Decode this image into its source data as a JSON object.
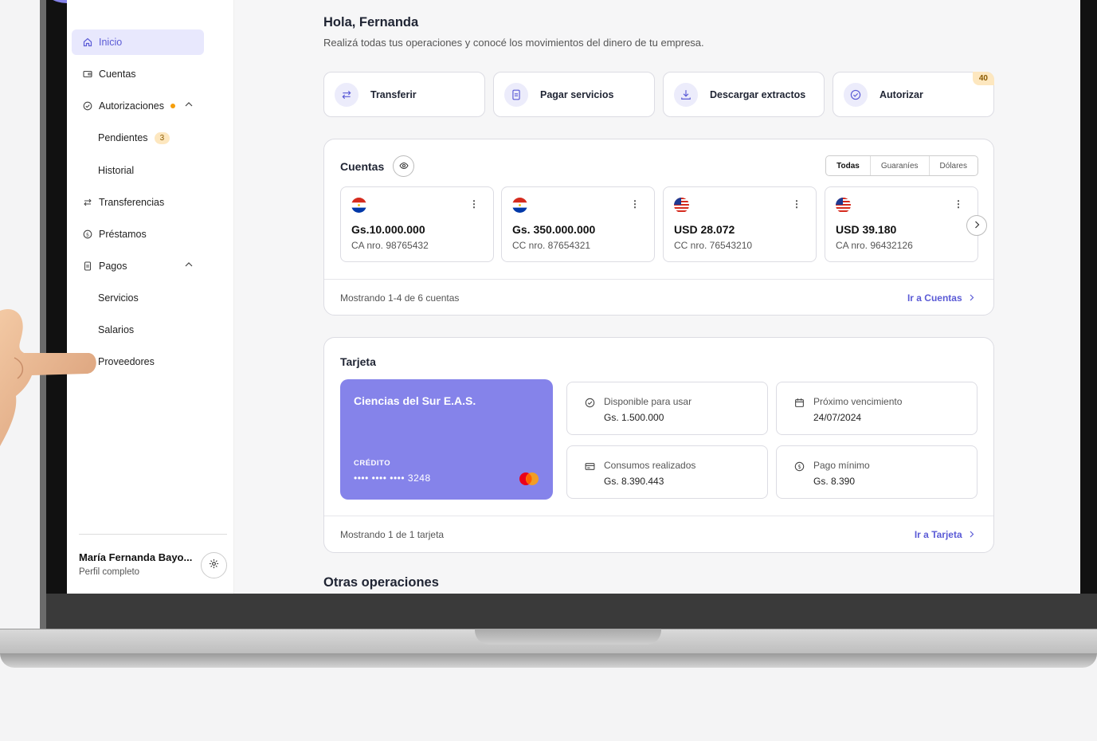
{
  "sidebar": {
    "items": [
      {
        "label": "Inicio",
        "icon": "home-icon"
      },
      {
        "label": "Cuentas",
        "icon": "wallet-icon"
      },
      {
        "label": "Autorizaciones",
        "icon": "check-circle-icon"
      },
      {
        "label": "Pendientes",
        "badge": "3"
      },
      {
        "label": "Historial"
      },
      {
        "label": "Transferencias",
        "icon": "transfer-icon"
      },
      {
        "label": "Préstamos",
        "icon": "dollar-circle-icon"
      },
      {
        "label": "Pagos",
        "icon": "document-icon"
      },
      {
        "label": "Servicios"
      },
      {
        "label": "Salarios"
      },
      {
        "label": "Proveedores"
      }
    ],
    "user": {
      "name": "María Fernanda Bayo...",
      "subtitle": "Perfil completo"
    }
  },
  "header": {
    "greeting": "Hola, Fernanda",
    "subtitle": "Realizá todas tus operaciones y conocé los movimientos del dinero de tu empresa."
  },
  "quick_actions": [
    {
      "label": "Transferir",
      "icon": "transfer-icon"
    },
    {
      "label": "Pagar servicios",
      "icon": "document-icon"
    },
    {
      "label": "Descargar extractos",
      "icon": "download-icon"
    },
    {
      "label": "Autorizar",
      "icon": "check-circle-icon",
      "badge": "40"
    }
  ],
  "accounts": {
    "title": "Cuentas",
    "filters": [
      "Todas",
      "Guaraníes",
      "Dólares"
    ],
    "selected_filter": "Todas",
    "items": [
      {
        "flag": "paraguay-flag",
        "amount": "Gs.10.000.000",
        "number": "CA nro. 98765432"
      },
      {
        "flag": "paraguay-flag",
        "amount": "Gs. 350.000.000",
        "number": "CC nro. 87654321"
      },
      {
        "flag": "usa-flag",
        "amount": "USD 28.072",
        "number": "CC nro. 76543210"
      },
      {
        "flag": "usa-flag",
        "amount": "USD 39.180",
        "number": "CA nro. 96432126"
      }
    ],
    "footer_note": "Mostrando 1-4 de 6 cuentas",
    "footer_link": "Ir a Cuentas"
  },
  "card_section": {
    "title": "Tarjeta",
    "card": {
      "holder": "Ciencias del Sur E.A.S.",
      "type": "CRÉDITO",
      "number": "•••• •••• •••• 3248",
      "color": "#8583ea",
      "brand": "mastercard-logo"
    },
    "info": [
      {
        "label": "Disponible para usar",
        "value": "Gs. 1.500.000",
        "icon": "check-circle-icon"
      },
      {
        "label": "Próximo vencimiento",
        "value": "24/07/2024",
        "icon": "calendar-icon"
      },
      {
        "label": "Consumos realizados",
        "value": "Gs. 8.390.443",
        "icon": "card-icon"
      },
      {
        "label": "Pago mínimo",
        "value": "Gs. 8.390",
        "icon": "dollar-circle-icon"
      }
    ],
    "footer_note": "Mostrando 1 de 1 tarjeta",
    "footer_link": "Ir a Tarjeta"
  },
  "other_ops": {
    "title": "Otras operaciones"
  },
  "colors": {
    "accent": "#5b5bd6",
    "accent_bg": "#e8e8fd",
    "card": "#8583ea",
    "badge_bg": "#fde7bf",
    "dot": "#f59e0b"
  }
}
